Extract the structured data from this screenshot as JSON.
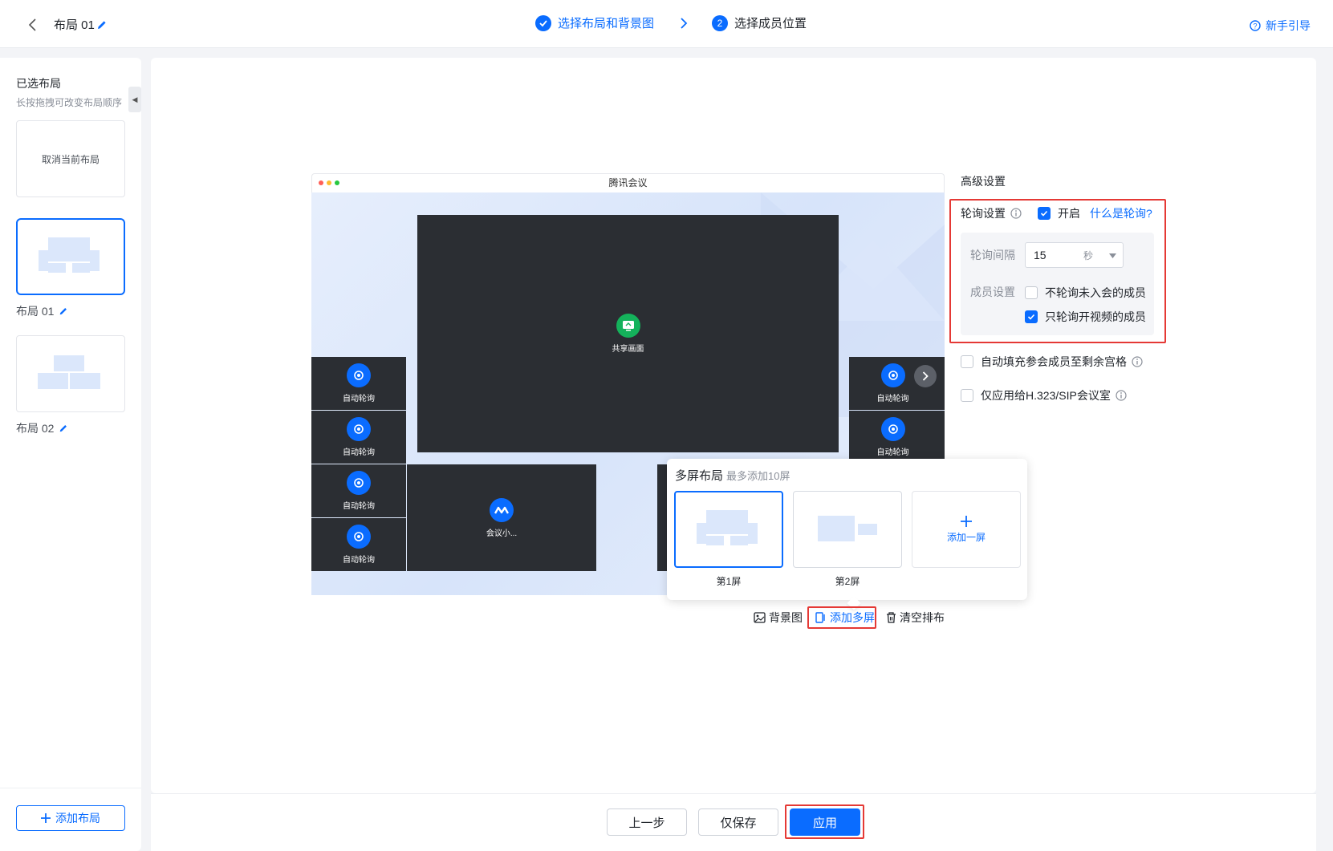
{
  "header": {
    "layout_name": "布局 01",
    "steps": [
      {
        "index": "✓",
        "label": "选择布局和背景图",
        "state": "done"
      },
      {
        "index": "2",
        "label": "选择成员位置",
        "state": "current"
      }
    ],
    "help_label": "新手引导"
  },
  "sidebar": {
    "title": "已选布局",
    "subtitle": "长按拖拽可改变布局顺序",
    "cancel_label": "取消当前布局",
    "layouts": [
      {
        "label": "布局 01",
        "selected": true
      },
      {
        "label": "布局 02",
        "selected": false
      }
    ],
    "add_label": "添加布局"
  },
  "preview": {
    "window_title": "腾讯会议",
    "main_tile_label": "共享画面",
    "auto_poll_label": "自动轮询",
    "meeting_tile_label": "会议小..."
  },
  "multi_screen": {
    "title": "多屏布局",
    "hint": "最多添加10屏",
    "screens": [
      {
        "label": "第1屏",
        "selected": true
      },
      {
        "label": "第2屏",
        "selected": false
      }
    ],
    "add_label": "添加一屏"
  },
  "toolbar": {
    "background_label": "背景图",
    "add_multi_label": "添加多屏",
    "clear_label": "清空排布"
  },
  "settings": {
    "title": "高级设置",
    "poll": {
      "label": "轮询设置",
      "enable_label": "开启",
      "enabled": true,
      "what_link": "什么是轮询?",
      "interval_label": "轮询间隔",
      "interval_value": "15",
      "interval_unit": "秒",
      "member_label": "成员设置",
      "opt_not_joined": "不轮询未入会的成员",
      "opt_not_joined_checked": false,
      "opt_video_only": "只轮询开视频的成员",
      "opt_video_only_checked": true
    },
    "autofill_label": "自动填充参会成员至剩余宫格",
    "autofill_checked": false,
    "h323_label": "仅应用给H.323/SIP会议室",
    "h323_checked": false
  },
  "footer": {
    "prev_label": "上一步",
    "save_label": "仅保存",
    "apply_label": "应用"
  },
  "colors": {
    "accent": "#0a6cff",
    "highlight": "#e53935",
    "tile": "#2b2e33",
    "share_green": "#14b25b"
  }
}
